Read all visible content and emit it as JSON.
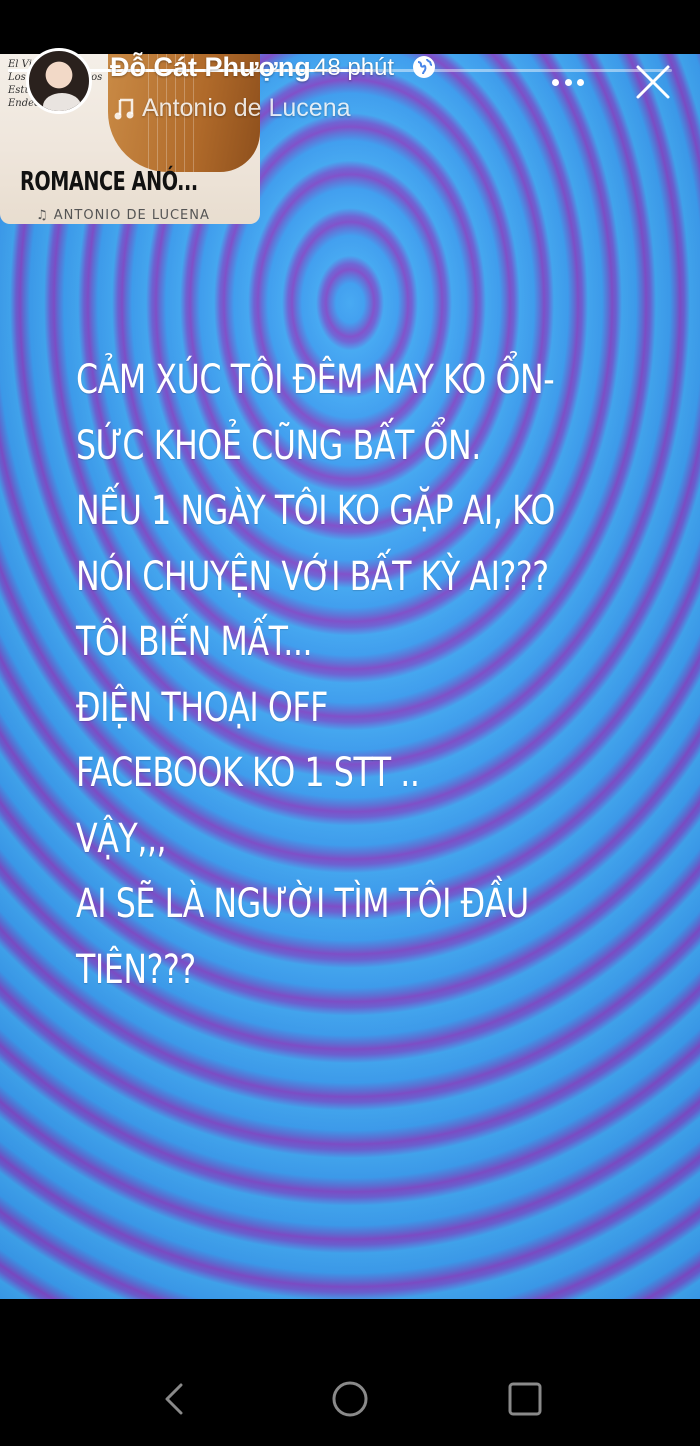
{
  "story": {
    "progress": 0.55,
    "user_name": "Đỗ Cát Phượng",
    "time_ago": "48 phút",
    "music": "Antonio de Lucena",
    "lines": [
      "CẢM XÚC TÔI ĐÊM NAY KO ỔN-",
      "SỨC KHOẺ CŨNG BẤT ỔN.",
      "NẾU 1 NGÀY  TÔI KO GẶP AI, KO",
      "NÓI CHUYỆN VỚI BẤT KỲ AI???",
      "TÔI BIẾN MẤT...",
      "ĐIỆN THOẠI OFF",
      "FACEBOOK KO 1 STT ..",
      "VẬY,,,",
      "AI SẼ LÀ NGƯỜI TÌM TÔI ĐẦU",
      "TIÊN???"
    ]
  },
  "album": {
    "tracks": [
      "El Vito",
      "Los Campanilleros",
      "Estudio Cano",
      "Endecha"
    ],
    "title": "ROMANCE ANÓ...",
    "artist": "♫ ANTONIO DE LUCENA"
  },
  "icons": {
    "globe": "globe-icon",
    "music": "music-note-icon",
    "more": "more-options-icon",
    "close": "close-icon",
    "back": "nav-back-icon",
    "home": "nav-home-icon",
    "recents": "nav-recents-icon"
  }
}
